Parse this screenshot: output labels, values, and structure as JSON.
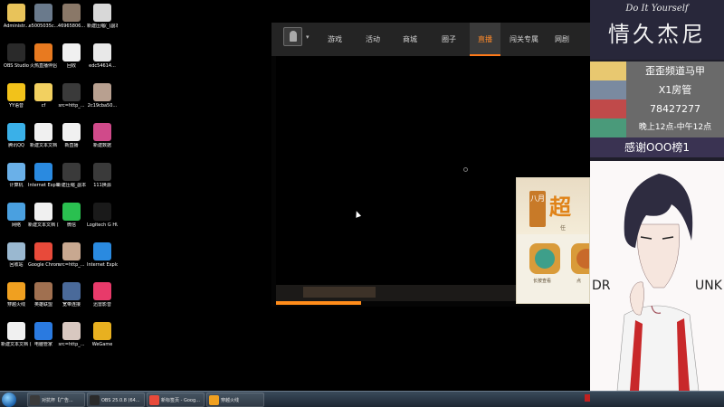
{
  "desktop": {
    "icons": [
      {
        "label": "Administr...",
        "color": "#e8c35a"
      },
      {
        "label": "e5005035c...",
        "color": "#6a7a8c"
      },
      {
        "label": "46965806...",
        "color": "#8a7868"
      },
      {
        "label": "新建压缩(_)副本 3333_副本",
        "color": "#d8d8d8"
      },
      {
        "label": "OBS Studio",
        "color": "#2a2a2a"
      },
      {
        "label": "火热直播伴侣",
        "color": "#e87a20"
      },
      {
        "label": "回收",
        "color": "#f0f0f0"
      },
      {
        "label": "edc54614...",
        "color": "#e8e8e8"
      },
      {
        "label": "YY语音",
        "color": "#f2c21a"
      },
      {
        "label": "cf",
        "color": "#f2d060"
      },
      {
        "label": "src=http_...",
        "color": "#3a3a3a"
      },
      {
        "label": "2c19cba50...",
        "color": "#b8a090"
      },
      {
        "label": "腾讯QQ",
        "color": "#3ab0e8"
      },
      {
        "label": "新建文本文档",
        "color": "#f0f0f0"
      },
      {
        "label": "新直播",
        "color": "#f0f0f0"
      },
      {
        "label": "新建数据",
        "color": "#d04a8a"
      },
      {
        "label": "计算机",
        "color": "#6ab0e8"
      },
      {
        "label": "Internet Explorer",
        "color": "#2a8ae0"
      },
      {
        "label": "新建压缩_副本",
        "color": "#3a3a3a"
      },
      {
        "label": "111换源",
        "color": "#3a3a3a"
      },
      {
        "label": "网络",
        "color": "#4aa0e0"
      },
      {
        "label": "新建文本文档 (2)",
        "color": "#f0f0f0"
      },
      {
        "label": "微信",
        "color": "#2ac050"
      },
      {
        "label": "Logitech G HUB",
        "color": "#1a1a1a"
      },
      {
        "label": "回收站",
        "color": "#9ab8d0"
      },
      {
        "label": "Google Chrome",
        "color": "#e84a3a"
      },
      {
        "label": "src=http_...",
        "color": "#c8a890"
      },
      {
        "label": "Internet Explorer",
        "color": "#2a8ae0"
      },
      {
        "label": "穿越火线",
        "color": "#f0a020"
      },
      {
        "label": "英雄联盟",
        "color": "#a07050"
      },
      {
        "label": "宽带连接",
        "color": "#4a6a9a"
      },
      {
        "label": "迅雷影音",
        "color": "#e83a6a"
      },
      {
        "label": "新建文本文档 (3)",
        "color": "#f0f0f0"
      },
      {
        "label": "电脑管家",
        "color": "#2a7ae0"
      },
      {
        "label": "src=http_...",
        "color": "#d8c8c0"
      },
      {
        "label": "WeGame",
        "color": "#e8b020"
      }
    ]
  },
  "launcher": {
    "tabs": [
      {
        "label": "游戏",
        "active": false
      },
      {
        "label": "活动",
        "active": false
      },
      {
        "label": "商城",
        "active": false
      },
      {
        "label": "圈子",
        "active": false
      },
      {
        "label": "直播",
        "active": true
      },
      {
        "label": "闯关专属",
        "active": false
      },
      {
        "label": "网剧",
        "active": false
      }
    ],
    "load_progress": 0.27,
    "promo": {
      "badge": "八月",
      "title": "超",
      "subtitle": "任",
      "button_left": "长按查看",
      "button_right": "点"
    }
  },
  "overlay": {
    "subtitle": "Do It Yourself",
    "name": "情久杰尼",
    "rows": [
      {
        "text": "歪歪频道马甲",
        "thumb_color": "#e8c870"
      },
      {
        "text": "X1房管",
        "thumb_color": "#7a8aa0"
      },
      {
        "text": "78427277",
        "thumb_color": "#c04a4a"
      },
      {
        "text": "晚上12点-中午12点",
        "thumb_color": "#4a9a7a"
      }
    ],
    "thanks": "感谢OOO榜1",
    "art_text_left": "DR",
    "art_text_right": "UNK"
  },
  "taskbar": {
    "buttons": [
      {
        "label": "对抗杯【广告...",
        "color": "#3a3a3a"
      },
      {
        "label": "OBS 25.0.8 (64...",
        "color": "#2a2a2a"
      },
      {
        "label": "新标签页 - Goog...",
        "color": "#e84a3a"
      },
      {
        "label": "穿越火线",
        "color": "#f0a020"
      }
    ]
  }
}
